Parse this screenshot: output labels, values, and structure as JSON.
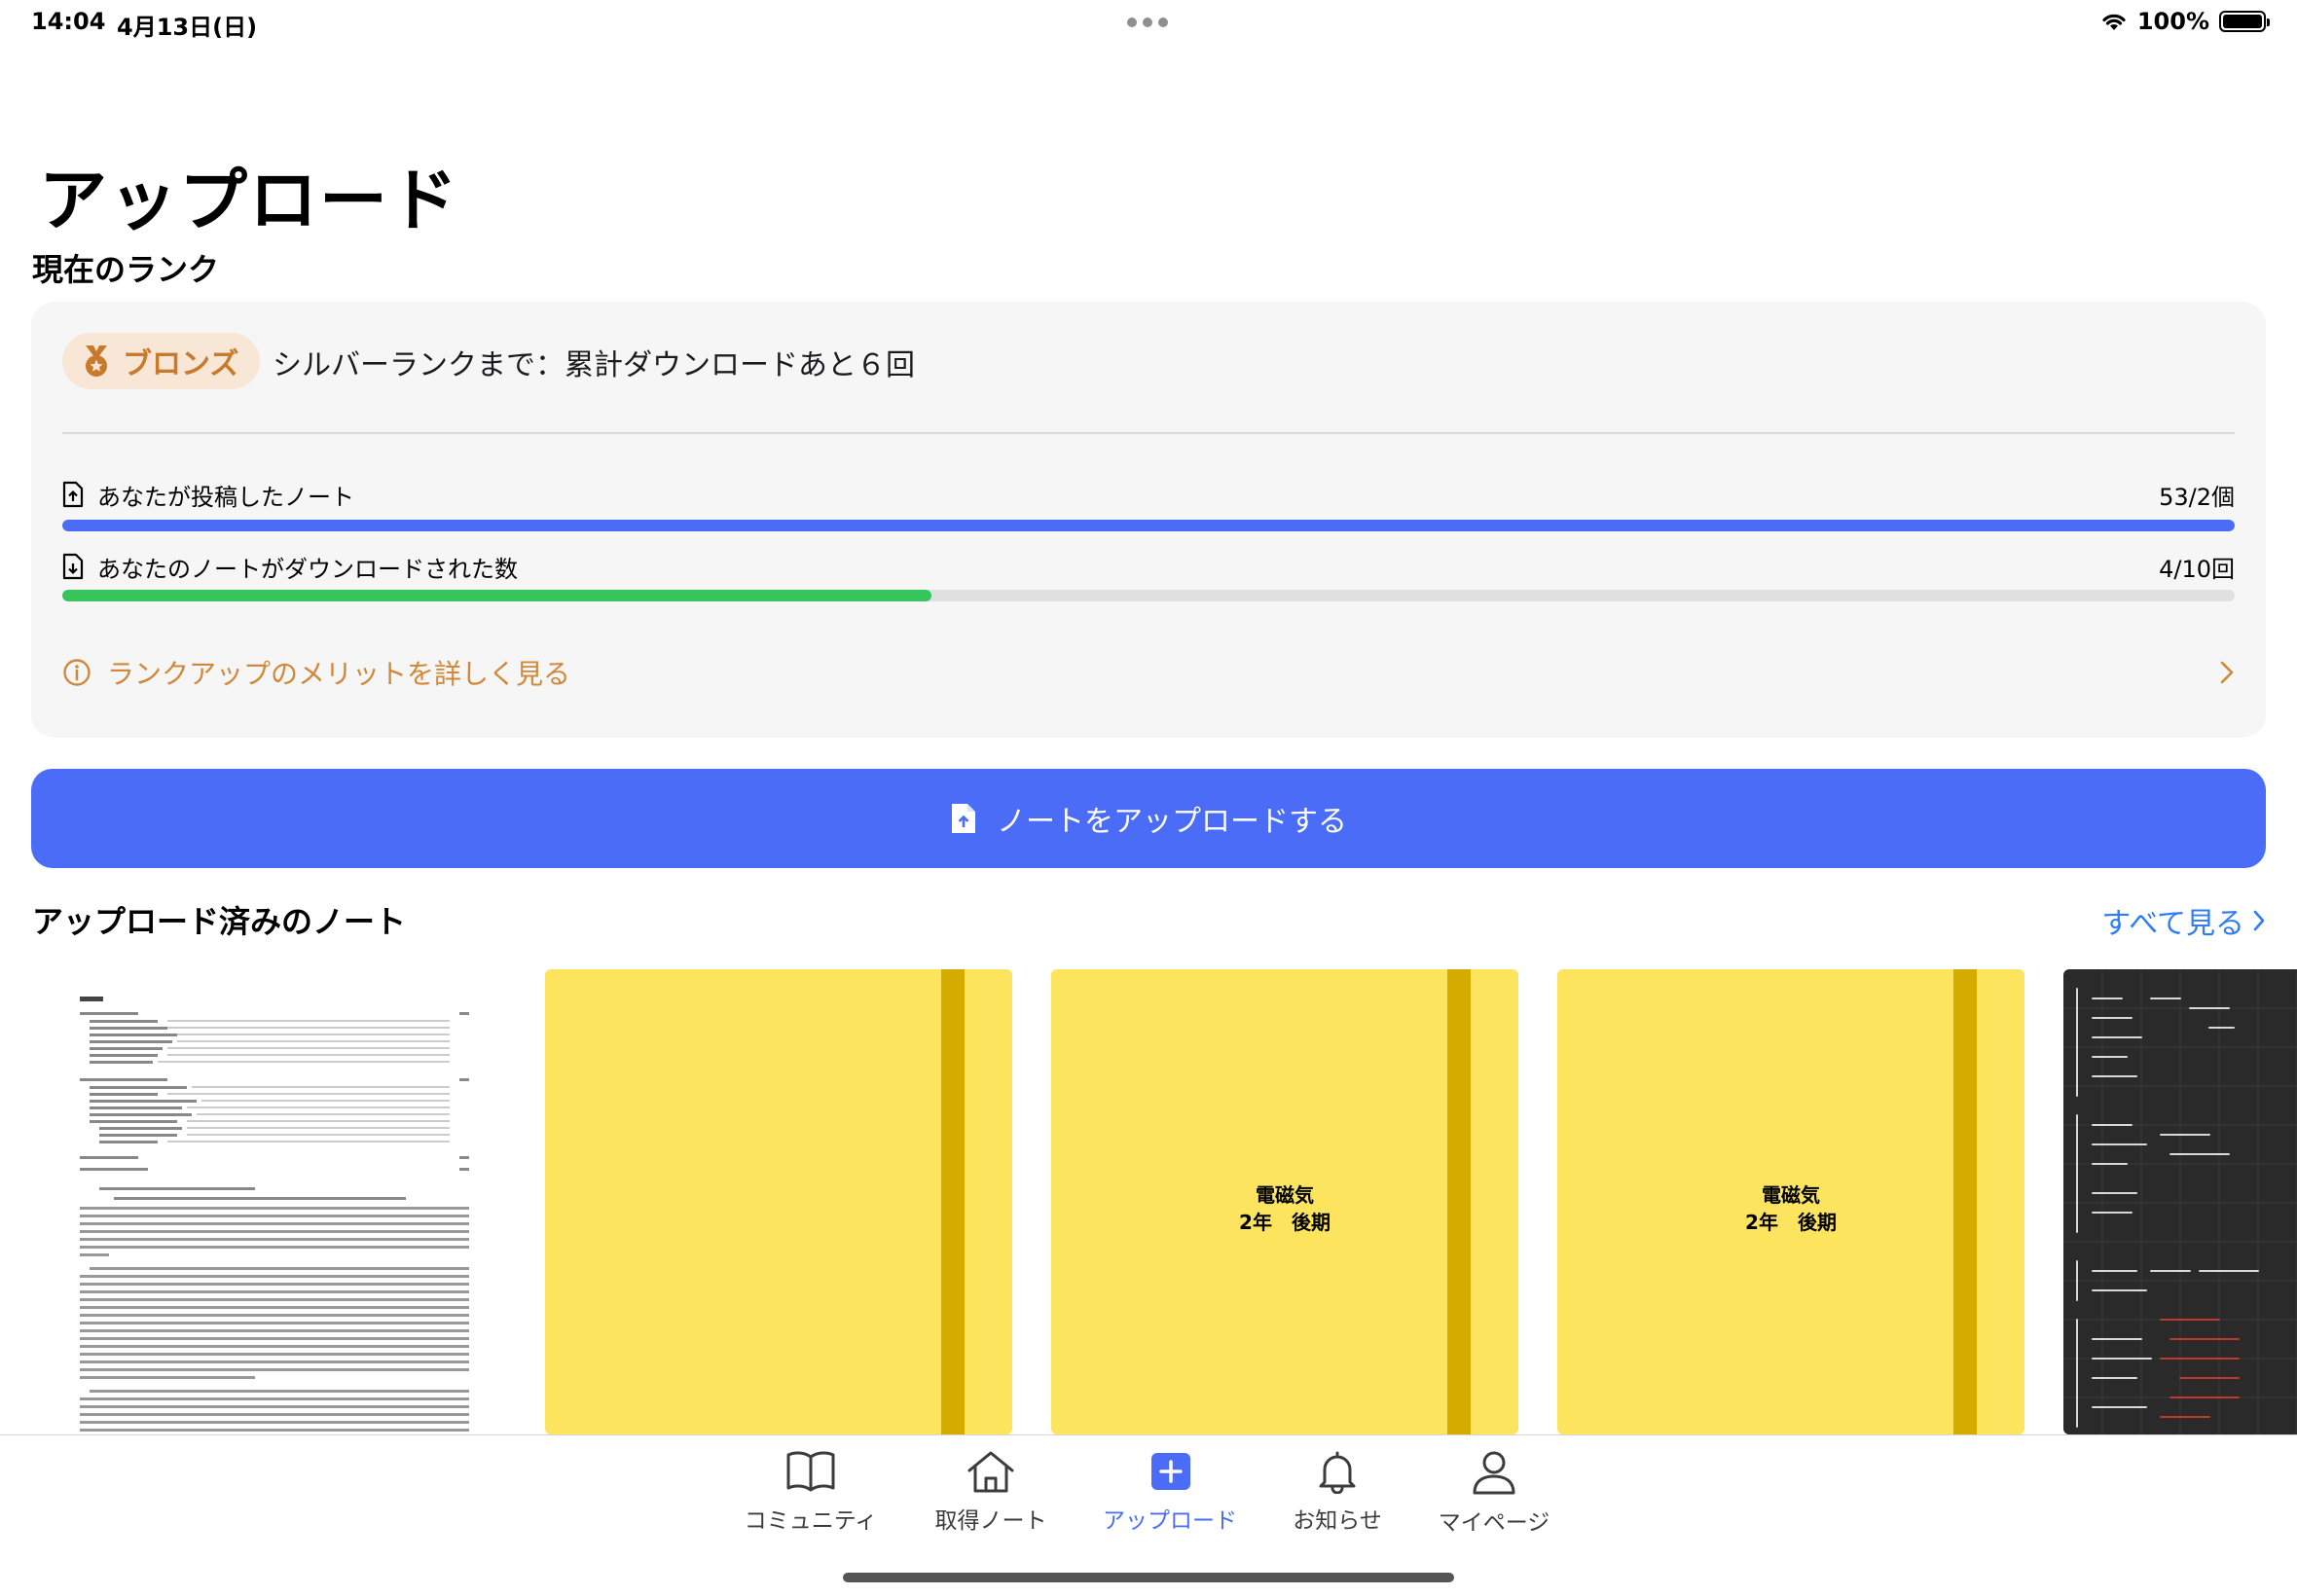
{
  "status_bar": {
    "time": "14:04",
    "date": "4月13日(日)",
    "battery": "100%"
  },
  "page_title": "アップロード",
  "rank_section": {
    "title": "現在のランク",
    "badge": "ブロンズ",
    "next_rank_text": "シルバーランクまで：累計ダウンロードあと６回",
    "stats": [
      {
        "label": "あなたが投稿したノート",
        "value": "53/2個",
        "progress": 1.0,
        "color": "#4a6cf7"
      },
      {
        "label": "あなたのノートがダウンロードされた数",
        "value": "4/10回",
        "progress": 0.4,
        "color": "#36c55a"
      }
    ],
    "merit_link": "ランクアップのメリットを詳しく見る"
  },
  "upload_button": "ノートをアップロードする",
  "uploaded_section": {
    "title": "アップロード済みのノート",
    "see_all": "すべて見る"
  },
  "notes": [
    {
      "type": "document"
    },
    {
      "type": "yellow-notebook",
      "label_line1": "",
      "label_line2": ""
    },
    {
      "type": "yellow-notebook",
      "label_line1": "電磁気",
      "label_line2": "2年　後期"
    },
    {
      "type": "yellow-notebook",
      "label_line1": "電磁気",
      "label_line2": "2年　後期"
    },
    {
      "type": "blackboard"
    }
  ],
  "tab_bar": {
    "items": [
      {
        "label": "コミュニティ",
        "icon": "book-icon"
      },
      {
        "label": "取得ノート",
        "icon": "home-icon"
      },
      {
        "label": "アップロード",
        "icon": "plus-square-icon",
        "active": true
      },
      {
        "label": "お知らせ",
        "icon": "bell-icon"
      },
      {
        "label": "マイページ",
        "icon": "person-icon"
      }
    ]
  },
  "colors": {
    "accent": "#4a6cf7",
    "bronze": "#c87a2c",
    "progress_green": "#36c55a",
    "link_blue": "#2f7cf6",
    "notebook_yellow": "#fde45f"
  }
}
